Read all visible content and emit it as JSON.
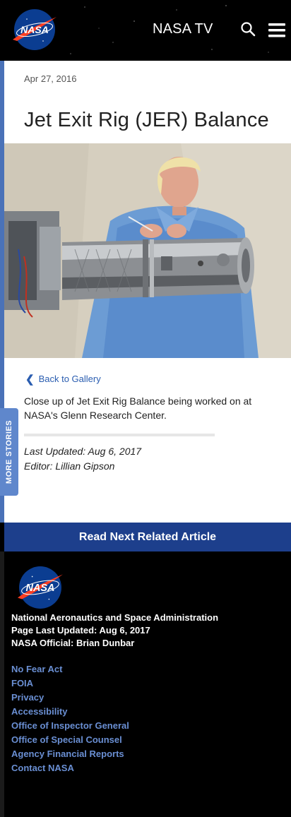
{
  "header": {
    "logo_text": "NASA",
    "nasa_tv": "NASA TV"
  },
  "article": {
    "date": "Apr 27, 2016",
    "title": "Jet Exit Rig (JER) Balance",
    "back_link": "Back to Gallery",
    "caption": "Close up of Jet Exit Rig Balance being worked on at NASA's Glenn Research Center.",
    "last_updated": "Last Updated: Aug 6, 2017",
    "editor": "Editor: Lillian Gipson"
  },
  "more_stories": "MORE STORIES",
  "read_next": "Read Next Related Article",
  "footer": {
    "logo_text": "NASA",
    "agency": "National Aeronautics and Space Administration",
    "page_updated": "Page Last Updated: Aug 6, 2017",
    "official": "NASA Official: Brian Dunbar",
    "links": [
      "No Fear Act",
      "FOIA",
      "Privacy",
      "Accessibility",
      "Office of Inspector General",
      "Office of Special Counsel",
      "Agency Financial Reports",
      "Contact NASA"
    ]
  },
  "colors": {
    "nasa_blue": "#0b3d91",
    "nasa_red": "#fc3d21",
    "link_blue": "#2a5db0",
    "read_next_bg": "#1d3f8c",
    "more_stories_bg": "#5f87cc"
  }
}
